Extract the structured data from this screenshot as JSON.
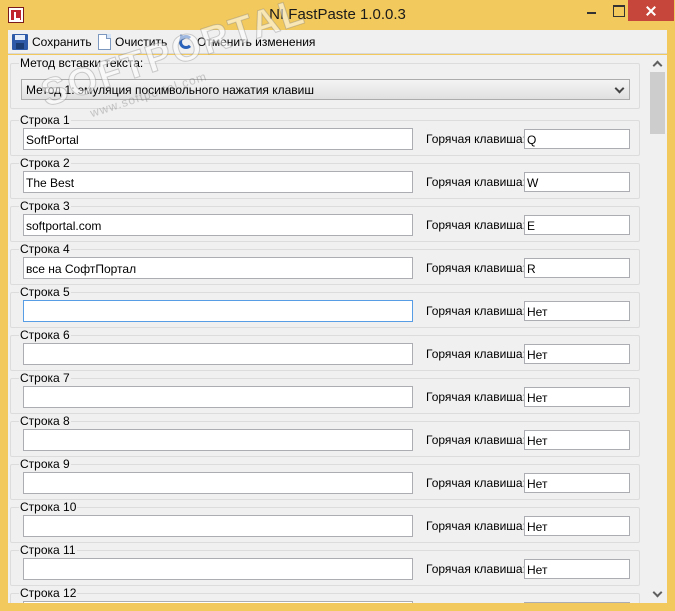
{
  "window": {
    "title": "NI FastPaste 1.0.0.3"
  },
  "toolbar": {
    "save_label": "Сохранить",
    "clear_label": "Очистить",
    "undo_label": "Отменить изменения"
  },
  "method": {
    "label": "Метод вставки текста:",
    "selected": "Метод 1: эмуляция посимвольного нажатия клавиш"
  },
  "hotkey_label": "Горячая клавиша:",
  "rows": [
    {
      "label": "Строка 1",
      "text": "SoftPortal",
      "hotkey": "Q"
    },
    {
      "label": "Строка 2",
      "text": "The Best",
      "hotkey": "W"
    },
    {
      "label": "Строка 3",
      "text": "softportal.com",
      "hotkey": "E"
    },
    {
      "label": "Строка 4",
      "text": "все на СофтПортал",
      "hotkey": "R"
    },
    {
      "label": "Строка 5",
      "text": "",
      "hotkey": "Нет"
    },
    {
      "label": "Строка 6",
      "text": "",
      "hotkey": "Нет"
    },
    {
      "label": "Строка 7",
      "text": "",
      "hotkey": "Нет"
    },
    {
      "label": "Строка 8",
      "text": "",
      "hotkey": "Нет"
    },
    {
      "label": "Строка 9",
      "text": "",
      "hotkey": "Нет"
    },
    {
      "label": "Строка 10",
      "text": "",
      "hotkey": "Нет"
    },
    {
      "label": "Строка 11",
      "text": "",
      "hotkey": "Нет"
    },
    {
      "label": "Строка 12",
      "text": "",
      "hotkey": ""
    }
  ],
  "watermark": {
    "main": "SOFTPORTAL",
    "sub": "www.softportal.com"
  }
}
